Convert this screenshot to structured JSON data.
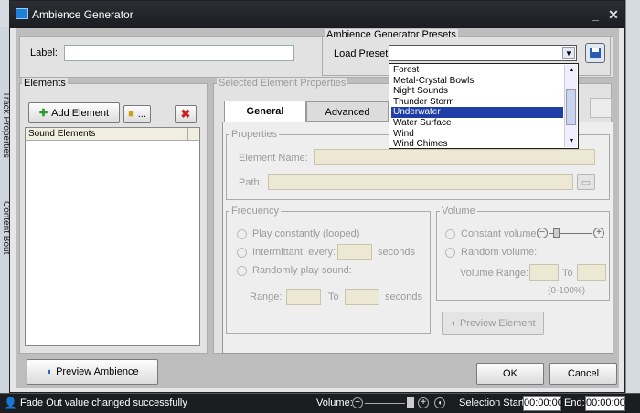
{
  "dialog": {
    "title": "Ambience Generator"
  },
  "background_app": {
    "left_tab_1": "Track Properties",
    "left_tab_2": "Content Bout"
  },
  "label_field": {
    "label": "Label:",
    "value": ""
  },
  "presets": {
    "group_title": "Ambience Generator Presets",
    "load_label": "Load Preset:",
    "value": "",
    "items": [
      "Forest",
      "Metal-Crystal Bowls",
      "Night Sounds",
      "Thunder Storm",
      "Underwater",
      "Water Surface",
      "Wind",
      "Wind Chimes"
    ],
    "selected_index": 4
  },
  "elements": {
    "group_title": "Elements",
    "add_label": "Add Element",
    "paste_label": "...",
    "list_header": "Sound Elements"
  },
  "properties": {
    "group_title": "Selected Element Properties",
    "tabs": [
      "General",
      "Advanced"
    ],
    "active_tab": 0,
    "props_title": "Properties",
    "name_label": "Element Name:",
    "path_label": "Path:",
    "frequency": {
      "title": "Frequency",
      "play_constantly": "Play constantly (looped)",
      "intermittent": "Intermittant, every:",
      "seconds1": "seconds",
      "randomly": "Randomly play sound:",
      "range": "Range:",
      "to": "To",
      "seconds2": "seconds"
    },
    "volume": {
      "title": "Volume",
      "constant": "Constant volume:",
      "random": "Random volume:",
      "range": "Volume Range:",
      "to": "To",
      "percent": "(0-100%)"
    },
    "preview_element": "Preview Element"
  },
  "buttons": {
    "preview_ambience": "Preview Ambience",
    "ok": "OK",
    "cancel": "Cancel"
  },
  "statusbar": {
    "message": "Fade Out value changed successfully",
    "volume_label": "Volume:",
    "selection_start_label": "Selection Start:",
    "selection_start_value": "00:00:00",
    "end_label": "End:",
    "end_value": "00:00:00"
  },
  "colors": {
    "selection": "#1f3ea8",
    "titlebar": "#1b1d21",
    "disabled_field": "#ece8d4"
  }
}
